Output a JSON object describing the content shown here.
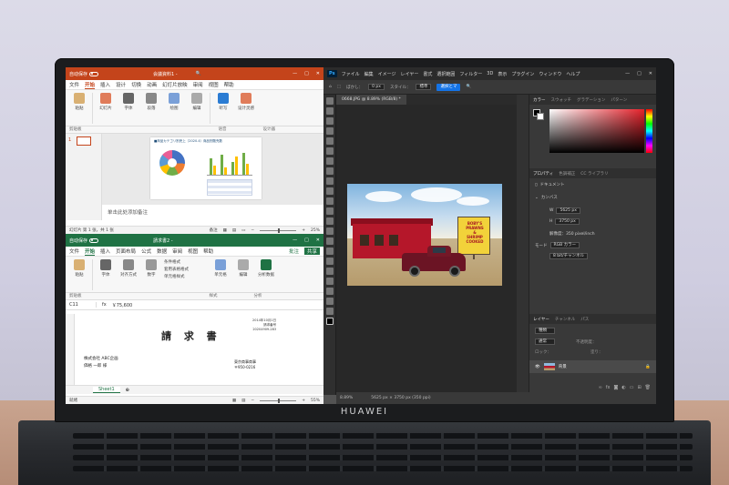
{
  "device": {
    "brand": "HUAWEI"
  },
  "ppt": {
    "titlebar": {
      "autosave": "自动保存",
      "title": "会議資料1 - ",
      "search": "🔍"
    },
    "menu": [
      "文件",
      "开始",
      "插入",
      "设计",
      "切换",
      "动画",
      "幻灯片放映",
      "审阅",
      "视图",
      "帮助"
    ],
    "ribbon": [
      "粘贴",
      "幻灯片",
      "字体",
      "段落",
      "绘图",
      "编辑",
      "听写",
      "设计灵感"
    ],
    "group_labels": [
      "剪贴板",
      "语音",
      "设计器"
    ],
    "slide_number": "1",
    "slide_title": "■商品カテゴリ別売上（2020.4）商品別販売数",
    "notes_placeholder": "单击此处添加备注",
    "status_left": "幻灯片 第 1 张，共 1 张",
    "status_notes": "备注",
    "zoom": "25%"
  },
  "xls": {
    "titlebar": {
      "autosave": "自动保存",
      "title": "請求書2 - "
    },
    "menu": [
      "文件",
      "开始",
      "插入",
      "页面布局",
      "公式",
      "数据",
      "审阅",
      "视图",
      "帮助"
    ],
    "comments": "批注",
    "share": "共享",
    "ribbon": [
      "粘贴",
      "字体",
      "对齐方式",
      "数字",
      "条件格式",
      "套用表格格式",
      "单元格样式",
      "单元格",
      "编辑",
      "分析数据"
    ],
    "group_labels": [
      "剪贴板",
      "样式",
      "分析"
    ],
    "name_box": "C11",
    "formula": "￥75,600",
    "doc_title": "請 求 書",
    "doc_date": "2014年10月1日",
    "doc_number": "請求番号",
    "doc_sub": "20204909-283",
    "company": "株式会社 ABC企画",
    "contact": "価格 一郎 様",
    "addr_name": "東京商事商事",
    "addr_zip": "〒950-0216",
    "sheet_tab": "Sheet1",
    "status": "就绪",
    "zoom": "55%"
  },
  "ps": {
    "logo": "Ps",
    "menu": [
      "ファイル",
      "編集",
      "イメージ",
      "レイヤー",
      "書式",
      "選択範囲",
      "フィルター",
      "3D",
      "表示",
      "プラグイン",
      "ウィンドウ",
      "ヘルプ"
    ],
    "options": {
      "feather_label": "ぼかし：",
      "feather_value": "0 px",
      "style_label": "スタイル：",
      "style_value": "標準",
      "mask_btn": "選択とマ"
    },
    "doc_tab": "0668.JPG @ 8.89% (RGB/8) *",
    "sign_text": [
      "BOBY'S",
      "PRAWNS",
      "&",
      "SHRIMP",
      "COOKED"
    ],
    "status_zoom": "8.89%",
    "status_size": "5625 px × 3750 px (350 ppi)",
    "color_tabs": [
      "カラー",
      "スウォッチ",
      "グラデーション",
      "パターン"
    ],
    "props_tabs": [
      "プロパティ",
      "色調補正",
      "CC ライブラリ"
    ],
    "props_doc": "ドキュメント",
    "canvas_label": "カンバス",
    "width_label": "W",
    "width_value": "5625 px",
    "height_label": "H",
    "height_value": "3750 px",
    "resolution": "解像度：350 pixel/inch",
    "mode_label": "モード",
    "mode_value": "RGB カラー",
    "bit_value": "8 bit/チャンネル",
    "layers_tabs": [
      "レイヤー",
      "チャンネル",
      "パス"
    ],
    "layer_kind": "種類",
    "layer_blend": "通常",
    "layer_opacity": "不透明度：",
    "layer_lock": "ロック：",
    "layer_fill": "塗り：",
    "layer_name": "背景"
  },
  "colors": {
    "ppt_accent": "#c4441b",
    "xls_accent": "#1f7244",
    "ps_accent": "#31a8ff",
    "ps_blue": "#1473e6"
  }
}
